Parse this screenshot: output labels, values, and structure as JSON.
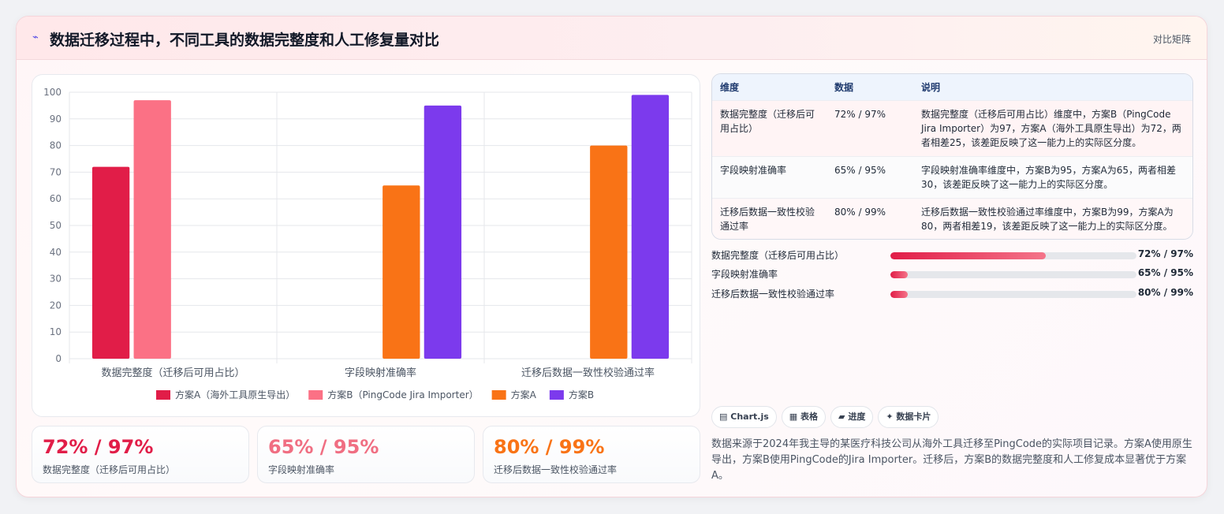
{
  "header": {
    "icon": "lightning-icon",
    "title": "数据迁移过程中，不同工具的数据完整度和人工修复量对比",
    "tag": "对比矩阵"
  },
  "chart_data": {
    "type": "bar",
    "categories": [
      "数据完整度（迁移后可用占比）",
      "字段映射准确率",
      "迁移后数据一致性校验通过率"
    ],
    "ylim": [
      0,
      100
    ],
    "yticks": [
      0,
      10,
      20,
      30,
      40,
      50,
      60,
      70,
      80,
      90,
      100
    ],
    "grid": true,
    "legend_position": "bottom",
    "series": [
      {
        "name": "方案A（海外工具原生导出）",
        "color": "#e11d48",
        "values": [
          72,
          null,
          null
        ]
      },
      {
        "name": "方案B（PingCode Jira Importer）",
        "color": "#fb7185",
        "values": [
          97,
          null,
          null
        ]
      },
      {
        "name": "方案A",
        "color": "#f97316",
        "values": [
          null,
          65,
          80
        ]
      },
      {
        "name": "方案B",
        "color": "#7c3aed",
        "values": [
          null,
          95,
          99
        ]
      }
    ]
  },
  "kpis": [
    {
      "value": "72% / 97%",
      "label": "数据完整度（迁移后可用占比）",
      "color": "#e11d48"
    },
    {
      "value": "65% / 95%",
      "label": "字段映射准确率",
      "color": "#f06e82"
    },
    {
      "value": "80% / 99%",
      "label": "迁移后数据一致性校验通过率",
      "color": "#f97316"
    }
  ],
  "table": {
    "headers": [
      "维度",
      "数据",
      "说明"
    ],
    "rows": [
      {
        "dimension": "数据完整度（迁移后可用占比）",
        "data": "72% / 97%",
        "desc": "数据完整度（迁移后可用占比）维度中，方案B（PingCode Jira Importer）为97，方案A（海外工具原生导出）为72，两者相差25，该差距反映了这一能力上的实际区分度。"
      },
      {
        "dimension": "字段映射准确率",
        "data": "65% / 95%",
        "desc": "字段映射准确率维度中，方案B为95，方案A为65，两者相差30，该差距反映了这一能力上的实际区分度。"
      },
      {
        "dimension": "迁移后数据一致性校验通过率",
        "data": "80% / 99%",
        "desc": "迁移后数据一致性校验通过率维度中，方案B为99，方案A为80，两者相差19，该差距反映了这一能力上的实际区分度。"
      }
    ]
  },
  "progress": [
    {
      "label": "数据完整度（迁移后可用占比）",
      "fill_percent": 63,
      "value": "72% / 97%"
    },
    {
      "label": "字段映射准确率",
      "fill_percent": 7,
      "value": "65% / 95%"
    },
    {
      "label": "迁移后数据一致性校验通过率",
      "fill_percent": 7,
      "value": "80% / 99%"
    }
  ],
  "chips": [
    {
      "icon": "▤",
      "label": "Chart.js"
    },
    {
      "icon": "▦",
      "label": "表格"
    },
    {
      "icon": "▰",
      "label": "进度"
    },
    {
      "icon": "✦",
      "label": "数据卡片"
    }
  ],
  "note": "数据来源于2024年我主导的某医疗科技公司从海外工具迁移至PingCode的实际项目记录。方案A使用原生导出，方案B使用PingCode的Jira Importer。迁移后，方案B的数据完整度和人工修复成本显著优于方案A。"
}
